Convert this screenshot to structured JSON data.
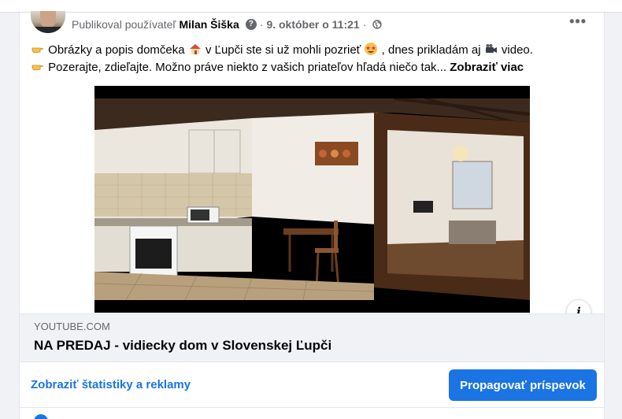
{
  "post": {
    "published_by_prefix": "Publikoval používateľ",
    "author": "Milan Šiška",
    "separator": "·",
    "date": "9. október o 11:21",
    "text_line1_a": "Obrázky a popis domčeka",
    "text_line1_b": "v Ľupči ste si už mohli pozrieť",
    "text_line1_c": ", dnes prikladám aj",
    "text_line1_d": "video.",
    "text_line2": "Pozerajte, zdieľajte. Možno práve niekto z vašich priateľov hľadá niečo tak...",
    "see_more": "Zobraziť viac"
  },
  "link_preview": {
    "domain": "YOUTUBE.COM",
    "title": "NA PREDAJ - vidiecky dom v Slovenskej Ľupči"
  },
  "actions": {
    "stats_label": "Zobraziť štatistiky a reklamy",
    "promote_label": "Propagovať príspevok"
  },
  "icons": {
    "help": "question-circle-icon",
    "privacy": "globe-icon",
    "more": "more-options-icon",
    "info": "info-icon",
    "pointing": "backhand-index-pointing-right-emoji",
    "house": "house-emoji",
    "star_eyes": "star-struck-emoji",
    "camera": "video-camera-emoji"
  },
  "colors": {
    "accent": "#1b74e4",
    "text": "#050505",
    "secondary": "#65676b",
    "background": "#f0f2f5"
  }
}
